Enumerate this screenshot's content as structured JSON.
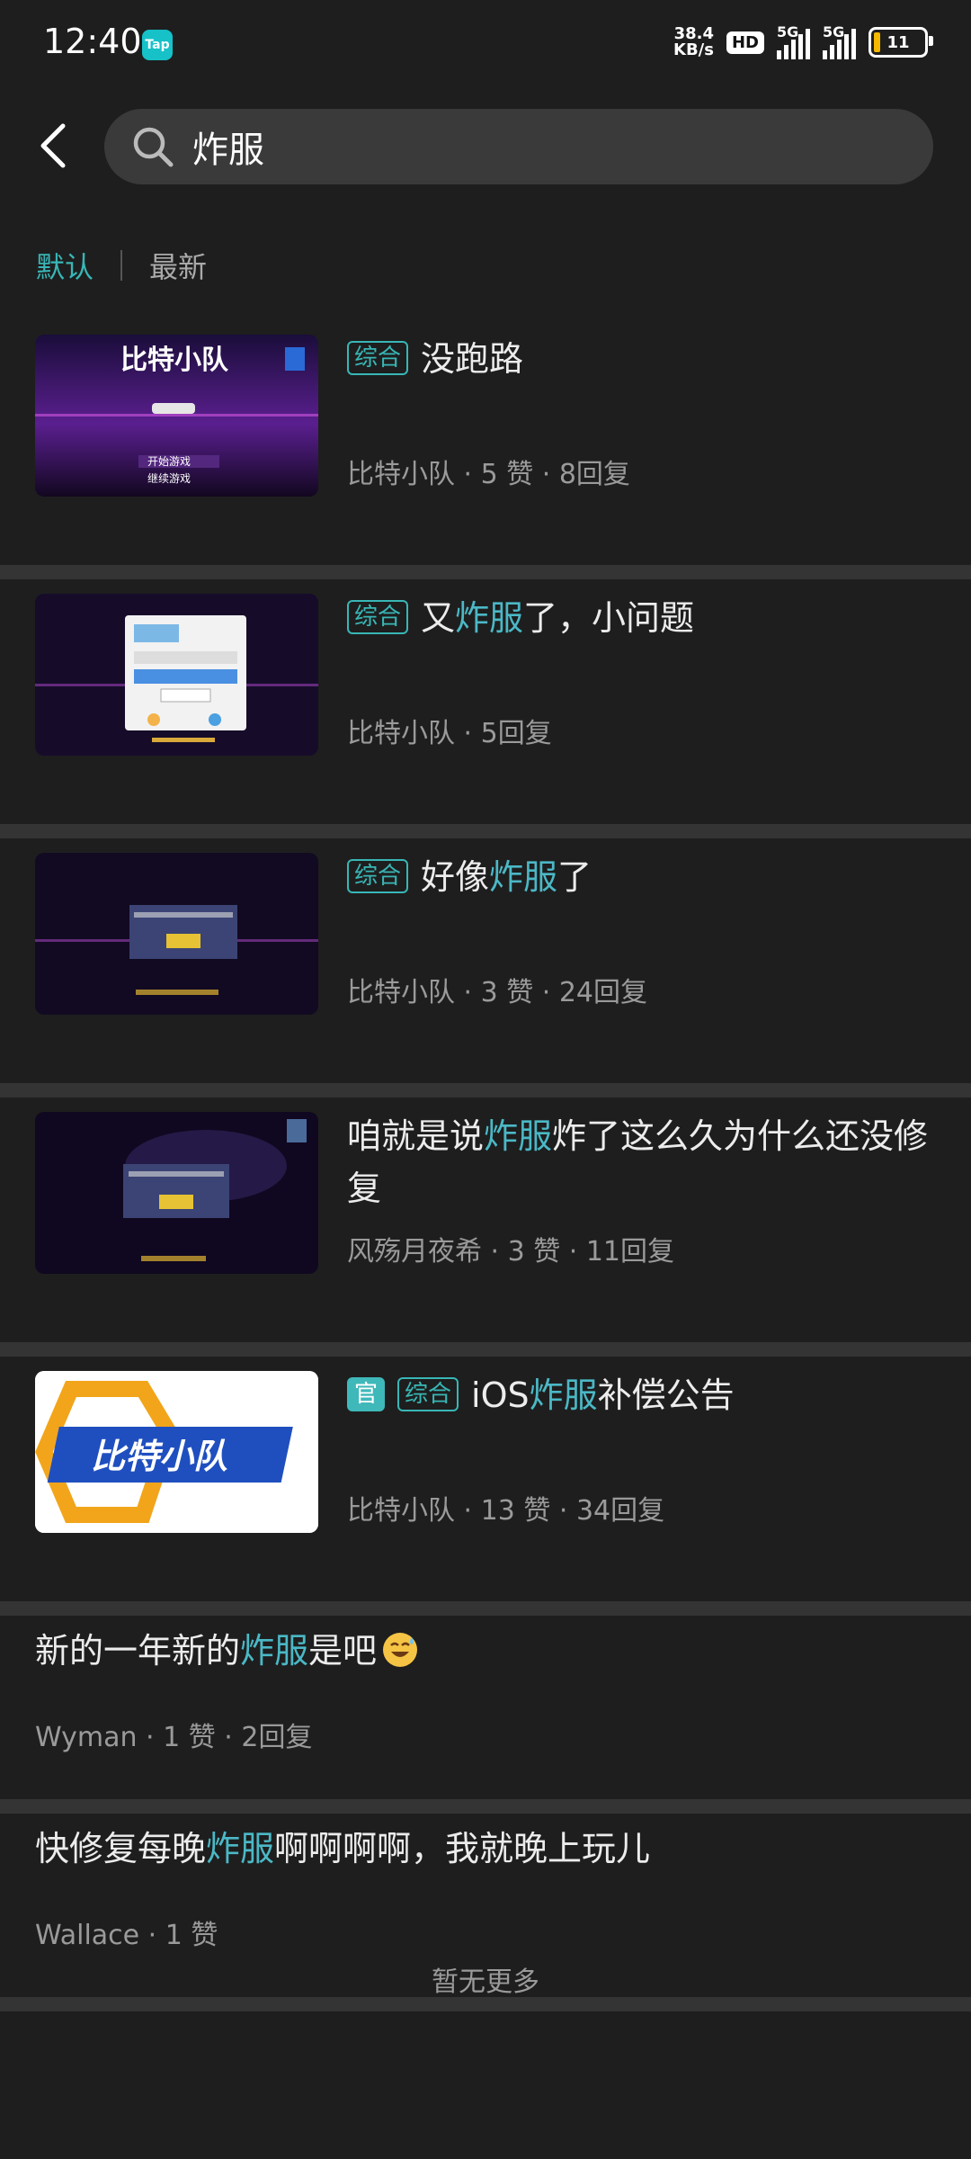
{
  "status": {
    "time": "12:40",
    "tap": "Tap",
    "speed_top": "38.4",
    "speed_unit": "KB/s",
    "hd": "HD",
    "sig1": "5G",
    "sig2": "5G",
    "battery": "11"
  },
  "search": {
    "query": "炸服"
  },
  "tabs": {
    "default": "默认",
    "latest": "最新"
  },
  "posts": [
    {
      "tag": "综合",
      "title_a": "没跑路",
      "author": "比特小队",
      "likes": "5 赞",
      "replies": "8回复",
      "thumb": "game-start-screen"
    },
    {
      "tag": "综合",
      "title_a": "又",
      "title_hl": "炸服",
      "title_b": "了，小问题",
      "author": "比特小队",
      "replies": "5回复",
      "thumb": "login-dialog-screen"
    },
    {
      "tag": "综合",
      "title_a": "好像",
      "title_hl": "炸服",
      "title_b": "了",
      "author": "比特小队",
      "likes": "3 赞",
      "replies": "24回复",
      "thumb": "error-dialog-screen"
    },
    {
      "title_a": "咱就是说",
      "title_hl": "炸服",
      "title_b": "炸了这么久为什么还没修复",
      "author": "风殇月夜希",
      "likes": "3 赞",
      "replies": "11回复",
      "thumb": "error-dialog-screen"
    },
    {
      "official": "官",
      "tag": "综合",
      "title_a": "iOS",
      "title_hl": "炸服",
      "title_b": "补偿公告",
      "author": "比特小队",
      "likes": "13 赞",
      "replies": "34回复",
      "thumb": "game-logo"
    },
    {
      "title_a": "新的一年新的",
      "title_hl": "炸服",
      "title_b": "是吧",
      "author": "Wyman",
      "likes": "1 赞",
      "replies": "2回复"
    },
    {
      "title_a": "快修复每晚",
      "title_hl": "炸服",
      "title_b": "啊啊啊啊，我就晚上玩儿",
      "author": "Wallace",
      "likes": "1 赞"
    }
  ],
  "thumb_text": {
    "start_title": "比特小队",
    "start_btn1": "开始游戏",
    "start_btn2": "继续游戏",
    "logo_text": "比特小队"
  },
  "footer": {
    "end": "暂无更多"
  }
}
